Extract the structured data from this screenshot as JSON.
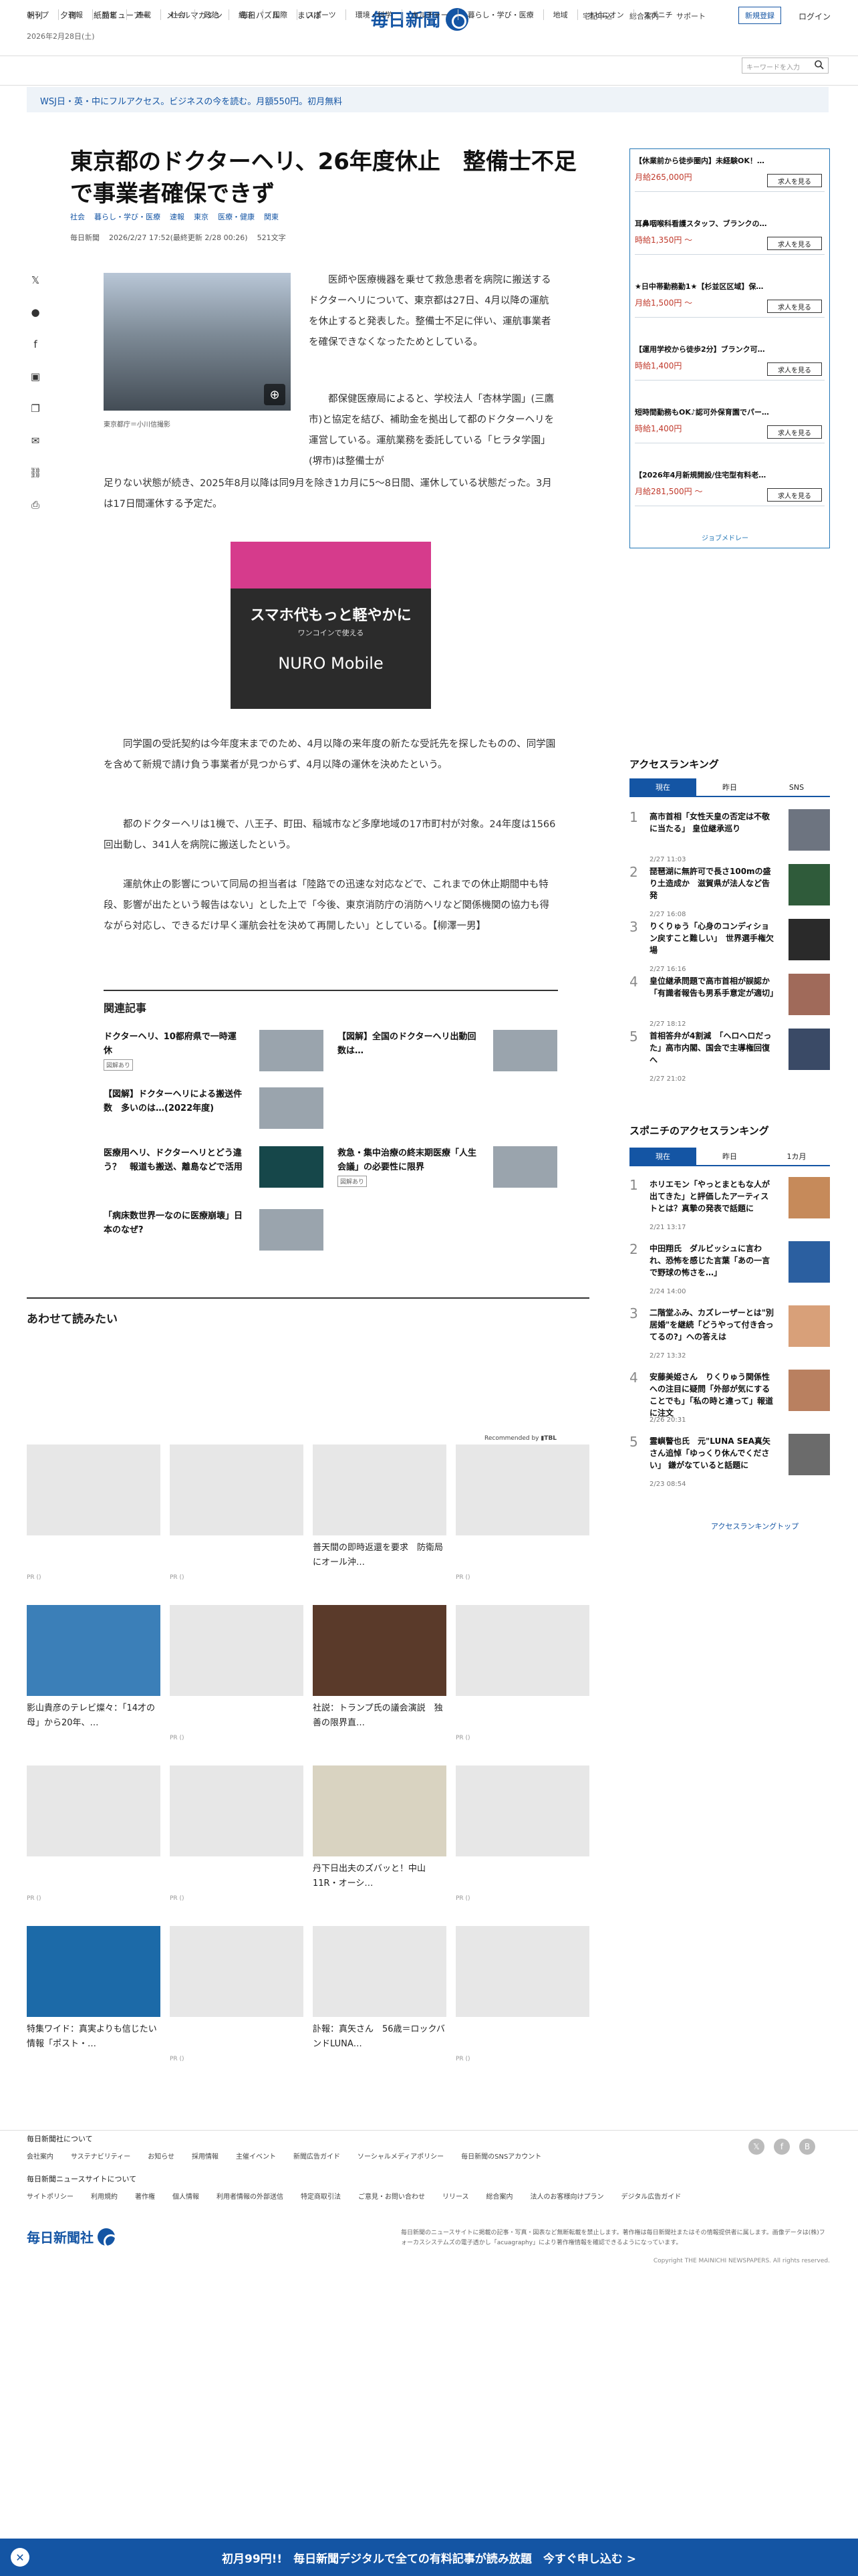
{
  "header": {
    "top_links": [
      "朝刊",
      "夕刊",
      "紙面ビューアー",
      "メールマガジン",
      "毎日パズル",
      "まいぽ"
    ],
    "date": "2026年2月28日(土)",
    "logo_text": "毎日新聞",
    "right_links": [
      "宅配申込",
      "総合案内",
      "サポート"
    ],
    "register": "新規登録",
    "login": "ログイン",
    "nav": [
      "トップ",
      "速報",
      "特集",
      "連載",
      "社会",
      "政治",
      "経済",
      "国際",
      "スポーツ",
      "環境・科学",
      "カルチャー",
      "暮らし・学び・医療",
      "地域",
      "オピニオン",
      "スポニチ"
    ],
    "search_placeholder": "キーワードを入力",
    "promo": "WSJ日・英・中にフルアクセス。ビジネスの今を読む。月額550円。初月無料"
  },
  "article": {
    "title": "東京都のドクターヘリ、26年度休止　整備士不足で事業者確保できず",
    "tags": [
      "社会",
      "暮らし・学び・医療",
      "速報",
      "東京",
      "医療・健康",
      "関東"
    ],
    "source": "毎日新聞",
    "updated": "2026/2/27 17:52(最終更新 2/28 00:26)",
    "chars": "521文字",
    "photo_caption": "東京都庁＝小川信撮影",
    "p1": "医師や医療機器を乗せて救急患者を病院に搬送するドクターヘリについて、東京都は27日、4月以降の運航を休止すると発表した。整備士不足に伴い、運航事業者を確保できなくなったためとしている。",
    "p2": "都保健医療局によると、学校法人「杏林学園」(三鷹市)と協定を結び、補助金を拠出して都のドクターヘリを運営している。運航業務を委託している「ヒラタ学園」(堺市)は整備士が",
    "p2b": "足りない状態が続き、2025年8月以降は同9月を除き1カ月に5～8日間、運休している状態だった。3月は17日間運休する予定だ。",
    "ad_text": "スマホ代もっと軽やかに",
    "ad_sub": "ワンコインで使える",
    "ad_brand": "NURO Mobile",
    "p3": "同学園の受託契約は今年度末までのため、4月以降の来年度の新たな受託先を探したものの、同学園を含めて新規で請け負う事業者が見つからず、4月以降の運休を決めたという。",
    "p4": "都のドクターヘリは1機で、八王子、町田、稲城市など多摩地域の17市町村が対象。24年度は1566回出動し、341人を病院に搬送したという。",
    "p5": "運航休止の影響について同局の担当者は「陸路での迅速な対応などで、これまでの休止期間中も特段、影響が出たという報告はない」とした上で「今後、東京消防庁の消防ヘリなど関係機関の協力も得ながら対応し、できるだけ早く運航会社を決めて再開したい」としている。【柳澤一男】"
  },
  "related": {
    "title": "関連記事",
    "items": [
      {
        "t": "ドクターヘリ、10都府県で一時運休",
        "badge": "図解あり"
      },
      {
        "t": "【図解】全国のドクターヘリ出動回数は…",
        "badge": ""
      },
      {
        "t": "【図解】ドクターヘリによる搬送件数　多いのは…(2022年度)",
        "badge": ""
      },
      {
        "t": "",
        "badge": ""
      },
      {
        "t": "医療用ヘリ、ドクターヘリとどう違う？　報道も搬送、離島などで活用",
        "badge": ""
      },
      {
        "t": "救急・集中治療の終末期医療「人生会議」の必要性に限界",
        "badge": "図解あり"
      },
      {
        "t": "「病床数世界一なのに医療崩壊」日本のなぜ?",
        "badge": ""
      }
    ]
  },
  "awasete": {
    "title": "あわせて読みたい",
    "recommended": "Recommended by",
    "cards": [
      {
        "cap": "",
        "pr": "PR ()"
      },
      {
        "cap": "",
        "pr": "PR ()"
      },
      {
        "cap": "普天間の即時返還を要求　防衛局にオール沖…",
        "pr": ""
      },
      {
        "cap": "",
        "pr": "PR ()"
      },
      {
        "cap": "影山貴彦のテレビ燦々：「14才の母」から20年、…",
        "pr": ""
      },
      {
        "cap": "",
        "pr": "PR ()"
      },
      {
        "cap": "社説：トランプ氏の議会演説　独善の限界直…",
        "pr": ""
      },
      {
        "cap": "",
        "pr": "PR ()"
      },
      {
        "cap": "",
        "pr": "PR ()"
      },
      {
        "cap": "",
        "pr": "PR ()"
      },
      {
        "cap": "丹下日出夫のズバッと！中山11R・オーシ…",
        "pr": ""
      },
      {
        "cap": "",
        "pr": "PR ()"
      },
      {
        "cap": "特集ワイド：真実よりも信じたい情報「ポスト・…",
        "pr": ""
      },
      {
        "cap": "",
        "pr": "PR ()"
      },
      {
        "cap": "訃報：真矢さん　56歳＝ロックバンドLUNA…",
        "pr": ""
      },
      {
        "cap": "",
        "pr": "PR ()"
      }
    ]
  },
  "jobs": [
    {
      "t": "【休業前から徒歩圏内】未経験OK！…",
      "s": "月給265,000円"
    },
    {
      "t": "耳鼻咽喉科看護スタッフ、ブランクの…",
      "s": "時給1,350円 〜"
    },
    {
      "t": "★日中帯勤務勤1★【杉並区区域】保…",
      "s": "月給1,500円 〜"
    },
    {
      "t": "【運用学校から徒歩2分】ブランク可…",
      "s": "時給1,400円"
    },
    {
      "t": "短時間勤務もOK♪認可外保育園でパー…",
      "s": "時給1,400円"
    },
    {
      "t": "【2026年4月新規開設/住宅型有料老…",
      "s": "月給281,500円 〜"
    }
  ],
  "job_button": "求人を見る",
  "job_footer": "ジョブメドレー",
  "ranking": {
    "title": "アクセスランキング",
    "tabs": [
      "現在",
      "昨日",
      "SNS"
    ],
    "items": [
      {
        "n": "1",
        "t": "高市首相「女性天皇の否定は不敬に当たる」 皇位継承巡り",
        "d": "2/27 11:03"
      },
      {
        "n": "2",
        "t": "琵琶湖に無許可で長さ100mの盛り土造成か　滋賀県が法人など告発",
        "d": "2/27 16:08"
      },
      {
        "n": "3",
        "t": "りくりゅう「心身のコンディション戻すこと難しい」　世界選手権欠場",
        "d": "2/27 16:16"
      },
      {
        "n": "4",
        "t": "皇位継承問題で高市首相が誤認か「有識者報告も男系手意定が適切」",
        "d": "2/27 18:12"
      },
      {
        "n": "5",
        "t": "首相答弁が4割減　「ヘロヘロだった」高市内閣、国会で主導権回復へ",
        "d": "2/27 21:02"
      }
    ]
  },
  "sponichi": {
    "title": "スポニチのアクセスランキング",
    "tabs": [
      "現在",
      "昨日",
      "1カ月"
    ],
    "items": [
      {
        "n": "1",
        "t": "ホリエモン「やっとまともな人が出てきた」と評価したアーティストとは？真摯の発表で話題に",
        "d": "2/21 13:17"
      },
      {
        "n": "2",
        "t": "中田翔氏　ダルビッシュに言われ、恐怖を感じた言葉「あの一言で野球の怖さを…」",
        "d": "2/24 14:00"
      },
      {
        "n": "3",
        "t": "二階堂ふみ、カズレーザーとは\"別居婚\"を継続「どうやって付き合ってるの?」への答えは",
        "d": "2/27 13:32"
      },
      {
        "n": "4",
        "t": "安藤美姫さん　りくりゅう関係性への注目に疑問「外部が気にすることでも」「私の時と違って」報道に注文",
        "d": "2/26 20:31"
      },
      {
        "n": "5",
        "t": "霊嶼警也氏　元\"LUNA SEA真矢さん追悼「ゆっくり休んでください」 鎌がなていると話題に",
        "d": "2/23 08:54"
      }
    ],
    "more": "アクセスランキングトップ"
  },
  "footer": {
    "h1": "毎日新聞社について",
    "l1": [
      "会社案内",
      "サステナビリティー",
      "お知らせ",
      "採用情報",
      "主催イベント",
      "新聞広告ガイド",
      "ソーシャルメディアポリシー",
      "毎日新聞のSNSアカウント"
    ],
    "h2": "毎日新聞ニュースサイトについて",
    "l2": [
      "サイトポリシー",
      "利用規約",
      "著作権",
      "個人情報",
      "利用者情報の外部送信",
      "特定商取引法",
      "ご意見・お問い合わせ",
      "リリース",
      "総合案内",
      "法人のお客様向けプラン",
      "デジタル広告ガイド"
    ],
    "company": "毎日新聞社",
    "notice": "毎日新聞のニュースサイトに掲載の記事・写真・図表など無断転載を禁止します。著作権は毎日新聞社またはその情報提供者に属します。画像データは(株)フォーカスシステムズの電子透かし「acuagraphy」により著作権情報を確認できるようになっています。",
    "copyright": "Copyright THE MAINICHI NEWSPAPERS. All rights reserved."
  },
  "bottom_bar": "初月99円!!　毎日新聞デジタルで全ての有料記事が読み放題　今すぐ申し込む >",
  "colors": {
    "brand": "#1455a4",
    "price": "#c0392b"
  }
}
